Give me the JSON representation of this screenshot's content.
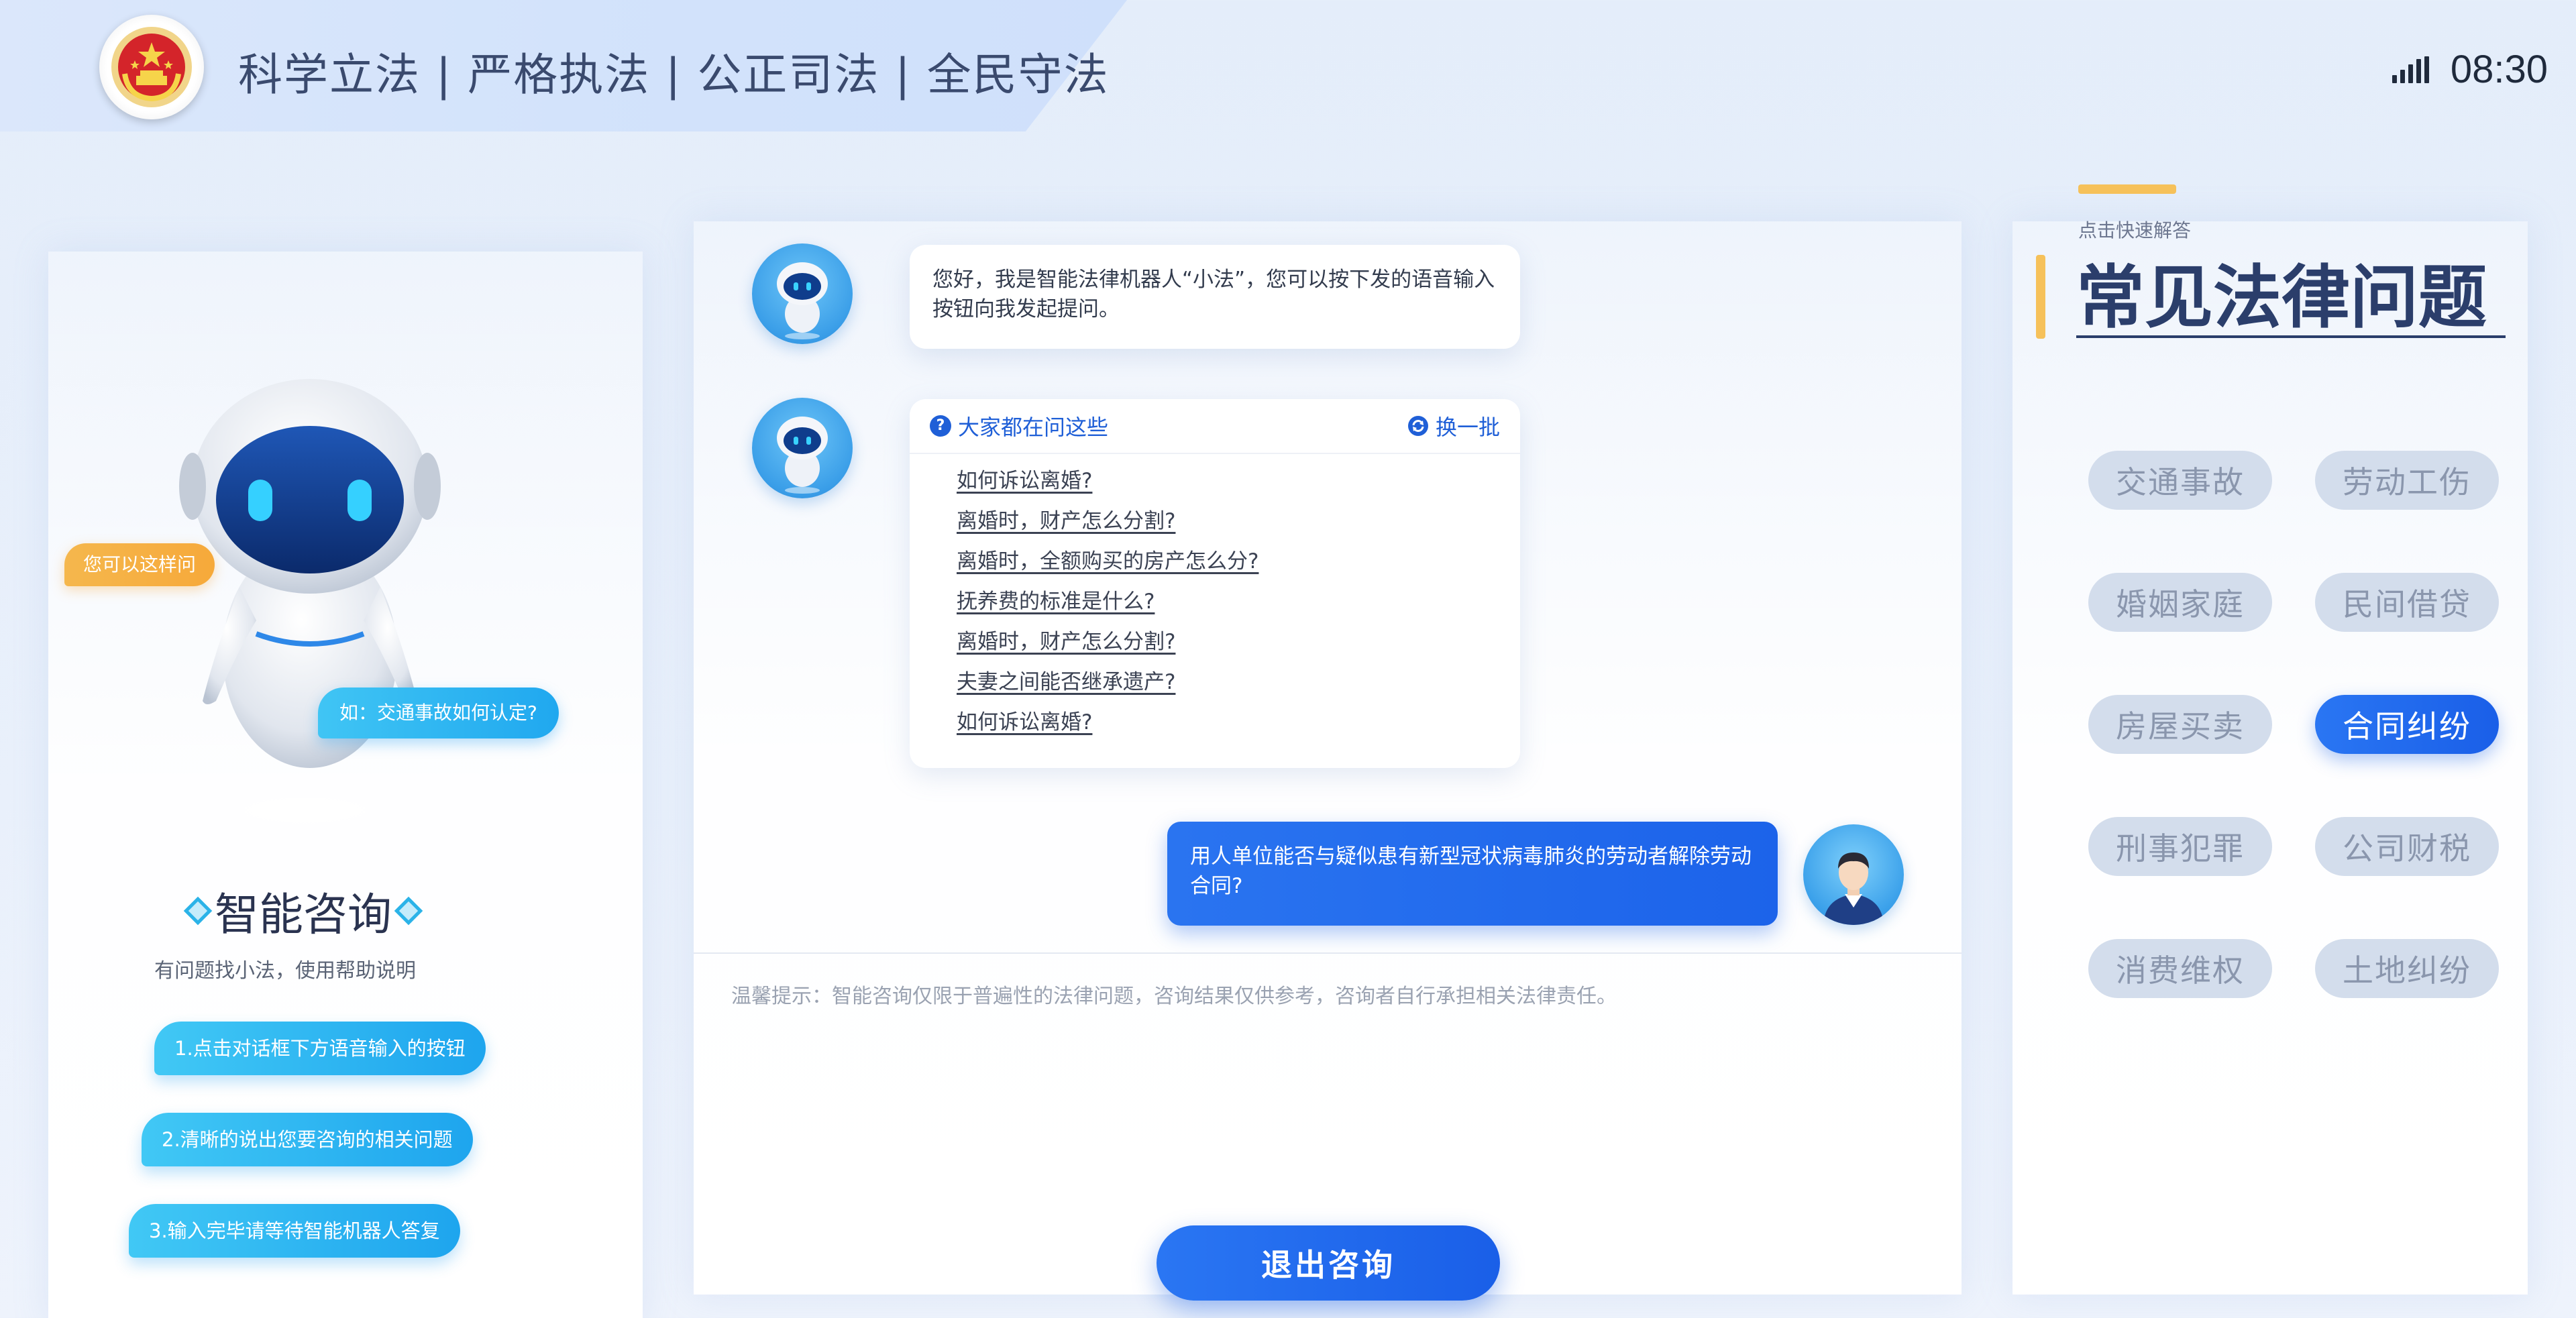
{
  "header": {
    "slogan": "科学立法 | 严格执法 |  公正司法 | 全民守法",
    "time": "08:30"
  },
  "left_panel": {
    "bubble_try": "您可以这样问",
    "bubble_example": "如：交通事故如何认定?",
    "title": "智能咨询",
    "help_text": "有问题找小法，使用帮助说明",
    "steps": [
      "1.点击对话框下方语音输入的按钮",
      "2.清晰的说出您要咨询的相关问题",
      "3.输入完毕请等待智能机器人答复"
    ]
  },
  "chat": {
    "greeting": "您好，我是智能法律机器人“小法”，您可以按下发的语音输入按钮向我发起提问。",
    "popular_title": "大家都在问这些",
    "refresh_label": "换一批",
    "questions": [
      "如何诉讼离婚?",
      "离婚时，财产怎么分割?",
      "离婚时，全额购买的房产怎么分?",
      "抚养费的标准是什么?",
      "离婚时，财产怎么分割?",
      "夫妻之间能否继承遗产?",
      "如何诉讼离婚?"
    ],
    "user_message": "用人单位能否与疑似患有新型冠状病毒肺炎的劳动者解除劳动合同?",
    "tip": "温馨提示：智能咨询仅限于普遍性的法律问题，咨询结果仅供参考，咨询者自行承担相关法律责任。",
    "exit_label": "退出咨询"
  },
  "faq": {
    "subtitle": "点击快速解答",
    "title": "常见法律问题",
    "categories": [
      "交通事故",
      "劳动工伤",
      "婚姻家庭",
      "民间借贷",
      "房屋买卖",
      "合同纠纷",
      "刑事犯罪",
      "公司财税",
      "消费维权",
      "土地纠纷"
    ],
    "active_category": "合同纠纷"
  },
  "colors": {
    "primary": "#1f63ea",
    "accent": "#f6c15a",
    "cyan": "#2bb3e8",
    "orange": "#f6a93a"
  }
}
